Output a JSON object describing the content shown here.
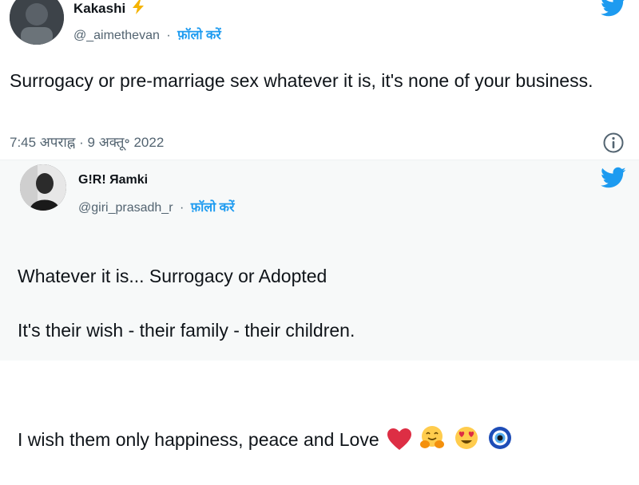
{
  "tweet1": {
    "name": "Kakashi",
    "handle": "@_aimethevan",
    "separator": "·",
    "follow_label": "फ़ॉलो करें",
    "text": "Surrogacy or pre-marriage sex whatever it is, it's none of your business.",
    "time": "7:45 अपराह्न",
    "date": "9 अक्तू॰ 2022"
  },
  "tweet2": {
    "name": "G!R! Яamki",
    "handle": "@giri_prasadh_r",
    "separator": "·",
    "follow_label": "फ़ॉलो करें",
    "line1": "Whatever it is... Surrogacy or Adopted",
    "line2": "It's their wish - their family - their children.",
    "line3": "I wish them only happiness, peace and Love"
  },
  "colors": {
    "twitter_blue": "#1d9bf0",
    "heart_red": "#e0245e"
  },
  "icons": [
    "lightning-icon",
    "twitter-bird-icon",
    "info-icon",
    "heart-emoji",
    "hugging-emoji",
    "heart-eyes-emoji",
    "nazar-amulet-emoji"
  ]
}
